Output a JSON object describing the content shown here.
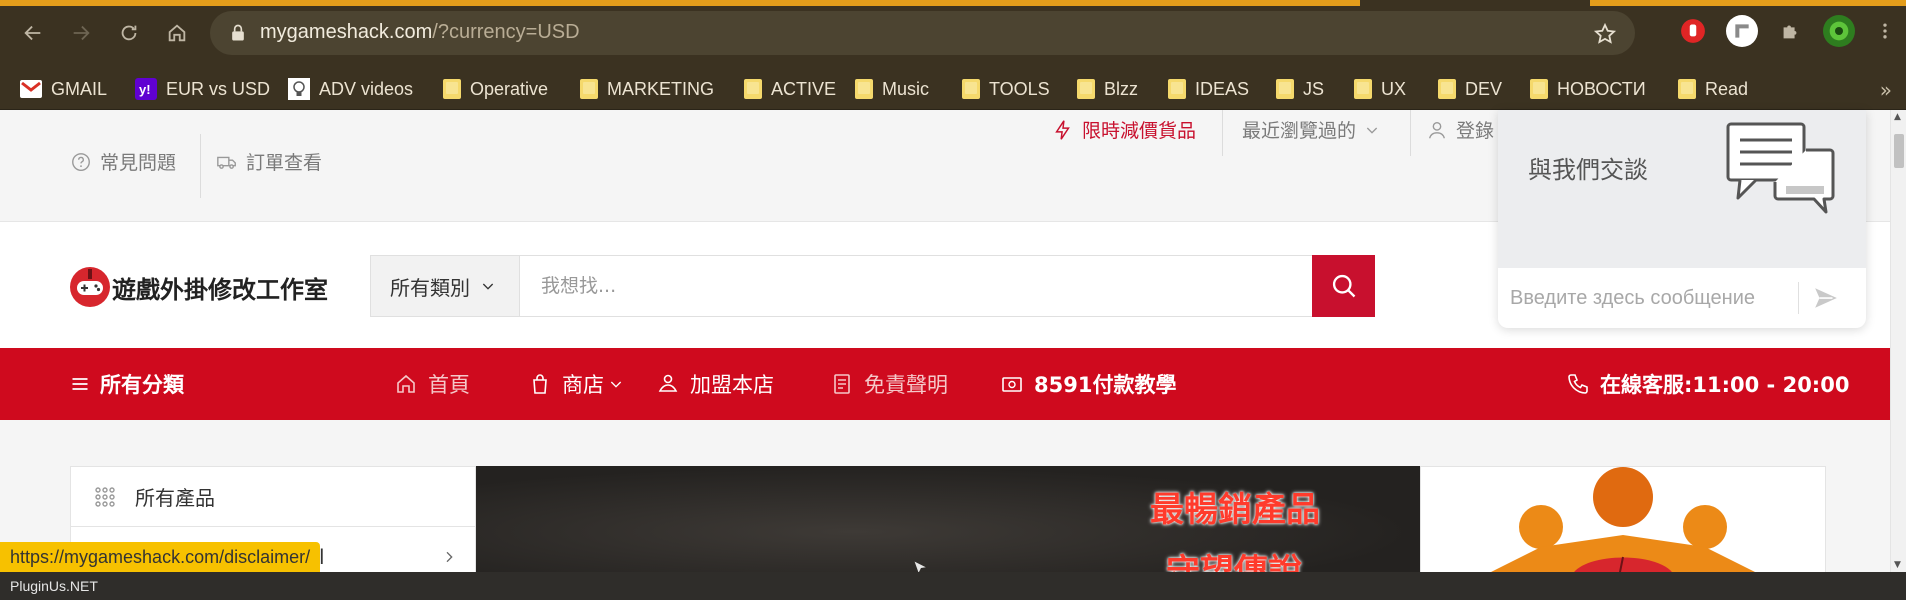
{
  "browser": {
    "url_host": "mygameshack.com",
    "url_path": "/?currency=USD",
    "bookmarks": [
      {
        "label": "GMAIL",
        "icon": "gmail-icon"
      },
      {
        "label": "EUR vs USD",
        "icon": "yahoo-icon"
      },
      {
        "label": "ADV videos",
        "icon": "bulb-icon"
      },
      {
        "label": "Operative",
        "icon": "folder-icon"
      },
      {
        "label": "MARKETING",
        "icon": "folder-icon"
      },
      {
        "label": "ACTIVE",
        "icon": "folder-icon"
      },
      {
        "label": "Music",
        "icon": "folder-icon"
      },
      {
        "label": "TOOLS",
        "icon": "folder-icon"
      },
      {
        "label": "Blzz",
        "icon": "folder-icon"
      },
      {
        "label": "IDEAS",
        "icon": "folder-icon"
      },
      {
        "label": "JS",
        "icon": "folder-icon"
      },
      {
        "label": "UX",
        "icon": "folder-icon"
      },
      {
        "label": "DEV",
        "icon": "folder-icon"
      },
      {
        "label": "НОВОСТИ",
        "icon": "folder-icon"
      },
      {
        "label": "Read",
        "icon": "folder-icon"
      }
    ],
    "status_url": "https://mygameshack.com/disclaimer/",
    "footer_text": "PluginUs.NET"
  },
  "topbar": {
    "faq": "常見問題",
    "order_check": "訂單查看",
    "flash_sale": "限時減價貨品",
    "recently_viewed": "最近瀏覽過的",
    "login": "登錄"
  },
  "header": {
    "logo_text": "遊戲外掛修改工作室",
    "category_select": "所有類別",
    "search_placeholder": "我想找..."
  },
  "nav": {
    "all_categories": "所有分類",
    "home": "首頁",
    "shop": "商店",
    "join": "加盟本店",
    "disclaimer": "免責聲明",
    "payment": "8591付款教學",
    "support": "在線客服:11:00 - 20:00"
  },
  "side_menu": {
    "all_products": "所有產品",
    "second_item": "l"
  },
  "banner": {
    "line1": "最暢銷產品",
    "line2": "守望傳說"
  },
  "chat": {
    "title": "與我們交談",
    "placeholder": "Введите здесь сообщение"
  },
  "colors": {
    "brand_red": "#cf0a1e",
    "chrome_bg": "#3b3221",
    "status_yellow": "#f7c100"
  }
}
